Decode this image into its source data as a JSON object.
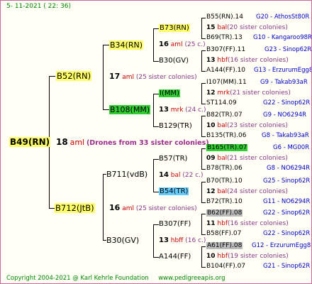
{
  "header": {
    "date": "5- 11-2021 ( 22: 36)"
  },
  "footer": {
    "copyright": "Copyright 2004-2021 @ Karl Kehrle Foundation",
    "site": "www.pedigreeapis.org"
  },
  "gen1": {
    "name": "B49(RN)",
    "count": "18",
    "mating": "aml",
    "note": "(Drones from 33 sister colonies)"
  },
  "gen2": [
    {
      "name": "B52(RN)"
    },
    {
      "name": "B712(JtB)"
    }
  ],
  "gen3": [
    {
      "name": "B34(RN)"
    },
    {
      "name": "B108(MM)"
    },
    {
      "name": "B711(vdB)"
    },
    {
      "name": "B30(GV)"
    }
  ],
  "gen3_notes": [
    {
      "count": "17",
      "mating": "aml",
      "note": "(25 sister colonies)"
    },
    {
      "count": "16",
      "mating": "aml",
      "note": "(25 sister colonies)"
    }
  ],
  "gen4": [
    {
      "name": "B73(RN)",
      "count": "16",
      "mating": "aml",
      "note": "(25 c.)"
    },
    {
      "name": "B30(GV)"
    },
    {
      "name": "I(MM)",
      "count": "13",
      "mating": "mrk",
      "note": "(24 c.)"
    },
    {
      "name": "B129(TR)"
    },
    {
      "name": "B57(TR)",
      "count": "14",
      "mating": "bal",
      "note": "(22 c.)"
    },
    {
      "name": "B54(TR)"
    },
    {
      "name": "B307(FF)",
      "count": "13",
      "mating": "hbff",
      "note": "(16 c.)"
    },
    {
      "name": "A144(FF)"
    }
  ],
  "gen5": [
    {
      "name": "B55(RN).14",
      "info": "G20 - AthosSt80R"
    },
    {
      "count": "15",
      "mating": "bal",
      "note": "(20 sister colonies)"
    },
    {
      "name": "B69(TR).13",
      "info": "G10 - Kangaroo98R"
    },
    {
      "name": "B307(FF).11",
      "info": "G23 - Sinop62R"
    },
    {
      "count": "13",
      "mating": "hbf",
      "note": "(16 sister colonies)"
    },
    {
      "name": "A144(FF).10",
      "info": "G13 - ErzurumEgg8"
    },
    {
      "name": "I107(MM).11",
      "info": "G9 - Takab93aR"
    },
    {
      "count": "12",
      "mating": "mrk",
      "note": "(21 sister colonies)"
    },
    {
      "name": "ST114.09",
      "info": "G22 - Sinop62R"
    },
    {
      "name": "B82(TR).07",
      "info": "G9 - NO6294R"
    },
    {
      "count": "10",
      "mating": "bal",
      "note": "(23 sister colonies)"
    },
    {
      "name": "B135(TR).06",
      "info": "G8 - Takab93aR"
    },
    {
      "name": "B165(TR).07",
      "info": "G6 - MG00R"
    },
    {
      "count": "09",
      "mating": "bal",
      "note": "(21 sister colonies)"
    },
    {
      "name": "B78(TR).06",
      "info": "G8 - NO6294R"
    },
    {
      "name": "B70(TR).10",
      "info": "G25 - Sinop62R"
    },
    {
      "count": "12",
      "mating": "bal",
      "note": "(24 sister colonies)"
    },
    {
      "name": "B72(TR).10",
      "info": "G11 - NO6294R"
    },
    {
      "name": "B62(FF).08",
      "info": "G22 - Sinop62R"
    },
    {
      "count": "11",
      "mating": "hbf",
      "note": "(16 sister colonies)"
    },
    {
      "name": "B58(FF).07",
      "info": "G22 - Sinop62R"
    },
    {
      "name": "A61(FF).08",
      "info": "G12 - ErzurumEgg8"
    },
    {
      "count": "10",
      "mating": "hbf",
      "note": "(19 sister colonies)"
    },
    {
      "name": "B104(FF).07",
      "info": "G21 - Sinop62R"
    }
  ],
  "colors": {
    "frame": "#cc6699",
    "yellow_box": "#ffff66",
    "green_box": "#33cc33",
    "cyan_box": "#66ccff",
    "grey_box": "#bbbbbb",
    "info_text": "#0000cc",
    "mating_text": "#cc0000",
    "header_text": "#008800"
  }
}
